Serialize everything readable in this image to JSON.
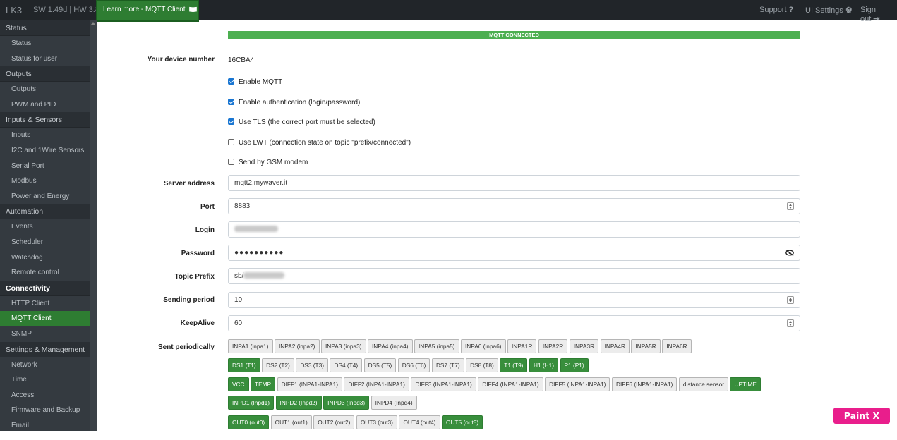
{
  "topbar": {
    "brand": "LK3",
    "version": "SW 1.49d | HW 3.8",
    "learn_more": "Learn more - MQTT Client",
    "support": "Support",
    "ui_settings": "UI Settings",
    "sign_out": "Sign out"
  },
  "sidebar": {
    "groups": [
      {
        "title": "Status",
        "items": [
          "Status",
          "Status for user"
        ]
      },
      {
        "title": "Outputs",
        "items": [
          "Outputs",
          "PWM and PID"
        ]
      },
      {
        "title": "Inputs & Sensors",
        "items": [
          "Inputs",
          "I2C and 1Wire Sensors",
          "Serial Port",
          "Modbus",
          "Power and Energy"
        ]
      },
      {
        "title": "Automation",
        "items": [
          "Events",
          "Scheduler",
          "Watchdog",
          "Remote control"
        ]
      },
      {
        "title": "Connectivity",
        "items": [
          "HTTP Client",
          "MQTT Client",
          "SNMP"
        ]
      },
      {
        "title": "Settings & Management",
        "items": [
          "Network",
          "Time",
          "Access",
          "Firmware and Backup",
          "Email"
        ]
      }
    ],
    "active_item": "MQTT Client"
  },
  "status_bar": "MQTT CONNECTED",
  "device": {
    "label": "Your device number",
    "value": "16CBA4"
  },
  "checkboxes": [
    {
      "label": "Enable MQTT",
      "checked": true
    },
    {
      "label": "Enable authentication (login/password)",
      "checked": true
    },
    {
      "label": "Use TLS (the correct port must be selected)",
      "checked": true
    },
    {
      "label": "Use LWT (connection state on topic \"prefix/connected\")",
      "checked": false
    },
    {
      "label": "Send by GSM modem",
      "checked": false
    }
  ],
  "fields": {
    "server_label": "Server address",
    "server_value": "mqtt2.mywaver.it",
    "port_label": "Port",
    "port_value": "8883",
    "login_label": "Login",
    "password_label": "Password",
    "password_value": "●●●●●●●●●●",
    "topic_label": "Topic Prefix",
    "topic_value": "sb/",
    "period_label": "Sending period",
    "period_value": "10",
    "keepalive_label": "KeepAlive",
    "keepalive_value": "60"
  },
  "sent_label": "Sent periodically",
  "chip_rows": [
    [
      {
        "t": "INPA1 (inpa1)",
        "on": false
      },
      {
        "t": "INPA2 (inpa2)",
        "on": false
      },
      {
        "t": "INPA3 (inpa3)",
        "on": false
      },
      {
        "t": "INPA4 (inpa4)",
        "on": false
      },
      {
        "t": "INPA5 (inpa5)",
        "on": false
      },
      {
        "t": "INPA6 (inpa6)",
        "on": false
      },
      {
        "t": "INPA1R",
        "on": false
      },
      {
        "t": "INPA2R",
        "on": false
      },
      {
        "t": "INPA3R",
        "on": false
      },
      {
        "t": "INPA4R",
        "on": false
      },
      {
        "t": "INPA5R",
        "on": false
      },
      {
        "t": "INPA6R",
        "on": false
      }
    ],
    [
      {
        "t": "DS1 (T1)",
        "on": true
      },
      {
        "t": "DS2 (T2)",
        "on": false
      },
      {
        "t": "DS3 (T3)",
        "on": false
      },
      {
        "t": "DS4 (T4)",
        "on": false
      },
      {
        "t": "DS5 (T5)",
        "on": false
      },
      {
        "t": "DS6 (T6)",
        "on": false
      },
      {
        "t": "DS7 (T7)",
        "on": false
      },
      {
        "t": "DS8 (T8)",
        "on": false
      },
      {
        "t": "T1 (T9)",
        "on": true
      },
      {
        "t": "H1 (H1)",
        "on": true
      },
      {
        "t": "P1 (P1)",
        "on": true
      }
    ],
    [
      {
        "t": "VCC",
        "on": true
      },
      {
        "t": "TEMP",
        "on": true
      },
      {
        "t": "DIFF1 (INPA1-INPA1)",
        "on": false
      },
      {
        "t": "DIFF2 (INPA1-INPA1)",
        "on": false
      },
      {
        "t": "DIFF3 (INPA1-INPA1)",
        "on": false
      },
      {
        "t": "DIFF4 (INPA1-INPA1)",
        "on": false
      },
      {
        "t": "DIFF5 (INPA1-INPA1)",
        "on": false
      },
      {
        "t": "DIFF6 (INPA1-INPA1)",
        "on": false
      },
      {
        "t": "distance sensor",
        "on": false
      },
      {
        "t": "UPTIME",
        "on": true
      }
    ],
    [
      {
        "t": "INPD1 (Inpd1)",
        "on": true
      },
      {
        "t": "INPD2 (Inpd2)",
        "on": true
      },
      {
        "t": "INPD3 (Inpd3)",
        "on": true
      },
      {
        "t": "INPD4 (Inpd4)",
        "on": false
      }
    ],
    [
      {
        "t": "OUT0 (out0)",
        "on": true
      },
      {
        "t": "OUT1 (out1)",
        "on": false
      },
      {
        "t": "OUT2 (out2)",
        "on": false
      },
      {
        "t": "OUT3 (out3)",
        "on": false
      },
      {
        "t": "OUT4 (out4)",
        "on": false
      },
      {
        "t": "OUT5 (out5)",
        "on": true
      }
    ]
  ],
  "watermark": "Paint X Lite",
  "colors": {
    "accent_green": "#2e7d32",
    "status_green": "#4caf50",
    "chip_on": "#388e3c",
    "checkbox_blue": "#1976d2",
    "badge_pink": "#e91e8c"
  }
}
